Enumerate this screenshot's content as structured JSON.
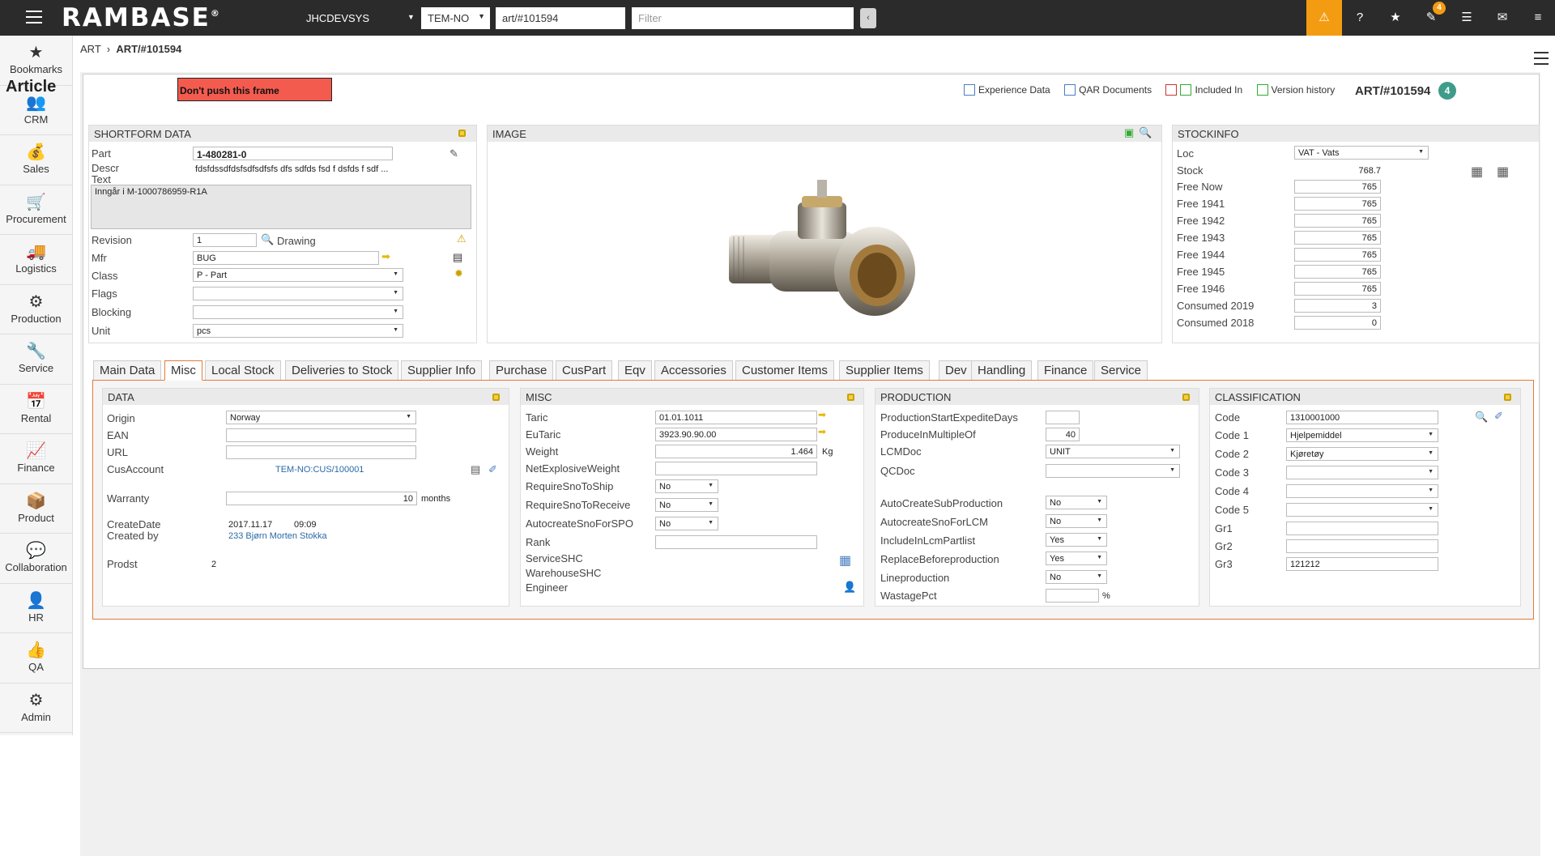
{
  "topbar": {
    "logo": "RAMBASE",
    "logo_mark": "®",
    "system": "JHCDEVSYS",
    "company": "TEM-NO",
    "path": "art/#101594",
    "filter_placeholder": "Filter",
    "badge_count": "4"
  },
  "nav": [
    {
      "label": "Bookmarks",
      "icon": "★"
    },
    {
      "label": "CRM",
      "icon": "👥"
    },
    {
      "label": "Sales",
      "icon": "💰"
    },
    {
      "label": "Procurement",
      "icon": "🛒"
    },
    {
      "label": "Logistics",
      "icon": "🚚"
    },
    {
      "label": "Production",
      "icon": "⚙"
    },
    {
      "label": "Service",
      "icon": "🔧"
    },
    {
      "label": "Rental",
      "icon": "📅"
    },
    {
      "label": "Finance",
      "icon": "📈"
    },
    {
      "label": "Product",
      "icon": "📦"
    },
    {
      "label": "Collaboration",
      "icon": "💬"
    },
    {
      "label": "HR",
      "icon": "👤"
    },
    {
      "label": "QA",
      "icon": "👍"
    },
    {
      "label": "Admin",
      "icon": "⚙"
    }
  ],
  "breadcrumb": {
    "root": "ART",
    "sep": "›",
    "current": "ART/#101594"
  },
  "header": {
    "title": "Article",
    "warning": "Don't push this frame",
    "links": [
      "Experience Data",
      "QAR Documents",
      "Included In",
      "Version history"
    ],
    "id": "ART/#101594",
    "badge": "4"
  },
  "shortform": {
    "title": "SHORTFORM DATA",
    "part_label": "Part",
    "part": "1-480281-0",
    "descr_label": "Descr",
    "descr": "fdsfdssdfdsfsdfsdfsfs dfs sdfds fsd f dsfds f sdf ...",
    "text_label": "Text",
    "text": "Inngår i M-1000786959-R1A",
    "revision_label": "Revision",
    "revision": "1",
    "drawing": "Drawing",
    "mfr_label": "Mfr",
    "mfr": "BUG",
    "class_label": "Class",
    "class": "P - Part",
    "flags_label": "Flags",
    "flags": "",
    "blocking_label": "Blocking",
    "blocking": "",
    "unit_label": "Unit",
    "unit": "pcs"
  },
  "image": {
    "title": "IMAGE"
  },
  "stockinfo": {
    "title": "STOCKINFO",
    "loc_label": "Loc",
    "loc": "VAT - Vats",
    "stock_label": "Stock",
    "stock": "768.7",
    "rows": [
      {
        "label": "Free Now",
        "value": "765"
      },
      {
        "label": "Free 1941",
        "value": "765"
      },
      {
        "label": "Free 1942",
        "value": "765"
      },
      {
        "label": "Free 1943",
        "value": "765"
      },
      {
        "label": "Free 1944",
        "value": "765"
      },
      {
        "label": "Free 1945",
        "value": "765"
      },
      {
        "label": "Free 1946",
        "value": "765"
      },
      {
        "label": "Consumed 2019",
        "value": "3"
      },
      {
        "label": "Consumed 2018",
        "value": "0"
      }
    ]
  },
  "tabs": [
    "Main Data",
    "Misc",
    "Local Stock",
    "Deliveries to Stock",
    "Supplier Info",
    "Purchase",
    "CusPart",
    "Eqv",
    "Accessories",
    "Customer Items",
    "Supplier Items",
    "Dev",
    "Handling",
    "Finance",
    "Service"
  ],
  "data": {
    "title": "DATA",
    "origin_label": "Origin",
    "origin": "Norway",
    "ean_label": "EAN",
    "ean": "",
    "url_label": "URL",
    "url": "",
    "cusaccount_label": "CusAccount",
    "cusaccount": "TEM-NO:CUS/100001",
    "warranty_label": "Warranty",
    "warranty": "10",
    "warranty_unit": "months",
    "createdate_label": "CreateDate",
    "createdate": "2017.11.17",
    "createtime": "09:09",
    "createdby_label": "Created by",
    "createdby": "233 Bjørn Morten Stokka",
    "prodst_label": "Prodst",
    "prodst": "2"
  },
  "misc": {
    "title": "MISC",
    "taric_label": "Taric",
    "taric": "01.01.1011",
    "eutaric_label": "EuTaric",
    "eutaric": "3923.90.90.00",
    "weight_label": "Weight",
    "weight": "1.464",
    "weight_unit": "Kg",
    "netexpl_label": "NetExplosiveWeight",
    "netexpl": "",
    "reqship_label": "RequireSnoToShip",
    "reqship": "No",
    "reqrecv_label": "RequireSnoToReceive",
    "reqrecv": "No",
    "autospo_label": "AutocreateSnoForSPO",
    "autospo": "No",
    "rank_label": "Rank",
    "rank": "",
    "serviceshc_label": "ServiceSHC",
    "warehouseshc_label": "WarehouseSHC",
    "engineer_label": "Engineer"
  },
  "production": {
    "title": "PRODUCTION",
    "startexp_label": "ProductionStartExpediteDays",
    "startexp": "",
    "multiple_label": "ProduceInMultipleOf",
    "multiple": "40",
    "lcmdoc_label": "LCMDoc",
    "lcmdoc": "UNIT",
    "qcdoc_label": "QCDoc",
    "qcdoc": "",
    "autosub_label": "AutoCreateSubProduction",
    "autosub": "No",
    "autolcm_label": "AutocreateSnoForLCM",
    "autolcm": "No",
    "inclcm_label": "IncludeInLcmPartlist",
    "inclcm": "Yes",
    "replace_label": "ReplaceBeforeproduction",
    "replace": "Yes",
    "lineprod_label": "Lineproduction",
    "lineprod": "No",
    "wastage_label": "WastagePct",
    "wastage": "",
    "wastage_unit": "%"
  },
  "classification": {
    "title": "CLASSIFICATION",
    "code_label": "Code",
    "code": "1310001000",
    "code1_label": "Code 1",
    "code1": "Hjelpemiddel",
    "code2_label": "Code 2",
    "code2": "Kjøretøy",
    "code3_label": "Code 3",
    "code3": "",
    "code4_label": "Code 4",
    "code4": "",
    "code5_label": "Code 5",
    "code5": "",
    "gr1_label": "Gr1",
    "gr1": "",
    "gr2_label": "Gr2",
    "gr2": "",
    "gr3_label": "Gr3",
    "gr3": "121212"
  }
}
